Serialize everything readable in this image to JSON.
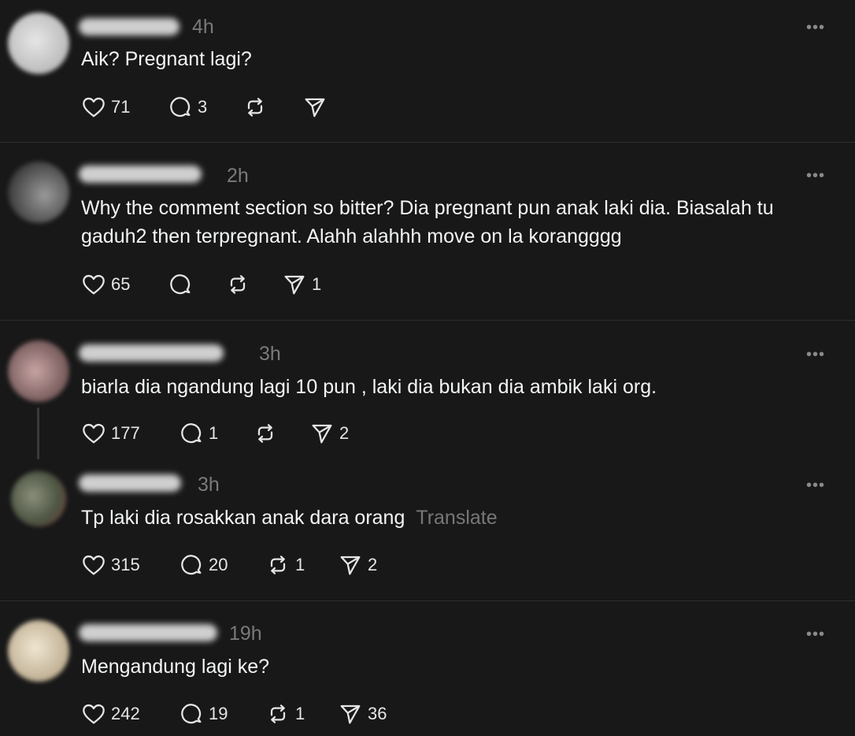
{
  "posts": [
    {
      "time": "4h",
      "text": "Aik? Pregnant lagi?",
      "likes": "71",
      "replies": "3",
      "reposts": "",
      "shares": ""
    },
    {
      "time": "2h",
      "text": "Why the comment section so bitter? Dia pregnant pun anak laki dia. Biasalah tu gaduh2 then terpregnant. Alahh alahhh move on la korangggg",
      "likes": "65",
      "replies": "",
      "reposts": "",
      "shares": "1"
    },
    {
      "time": "3h",
      "text": "biarla dia ngandung lagi 10 pun , laki dia bukan dia ambik laki org.",
      "likes": "177",
      "replies": "1",
      "reposts": "",
      "shares": "2"
    },
    {
      "time": "3h",
      "text": "Tp laki dia rosakkan anak dara orang",
      "translate": "Translate",
      "likes": "315",
      "replies": "20",
      "reposts": "1",
      "shares": "2"
    },
    {
      "time": "19h",
      "text": "Mengandung lagi ke?",
      "likes": "242",
      "replies": "19",
      "reposts": "1",
      "shares": "36"
    }
  ],
  "more_glyph": "•••",
  "colors": {
    "background": "#181818",
    "text": "#f3f5f7",
    "muted": "#7a7a7a",
    "divider": "#2e2e2e"
  },
  "icons": [
    "heart-icon",
    "comment-icon",
    "repost-icon",
    "share-icon",
    "more-icon"
  ]
}
